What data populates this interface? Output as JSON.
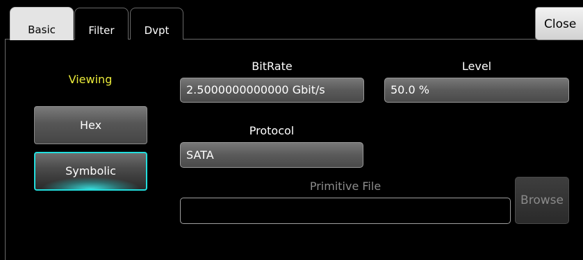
{
  "tabs": [
    {
      "label": "Basic",
      "active": true
    },
    {
      "label": "Filter",
      "active": false
    },
    {
      "label": "Dvpt",
      "active": false
    }
  ],
  "close_label": "Close",
  "viewing": {
    "title": "Viewing",
    "options": [
      {
        "label": "Hex",
        "selected": false
      },
      {
        "label": "Symbolic",
        "selected": true
      }
    ]
  },
  "bitrate": {
    "label": "BitRate",
    "value": "2.5000000000000 Gbit/s"
  },
  "level": {
    "label": "Level",
    "value": "50.0 %"
  },
  "protocol": {
    "label": "Protocol",
    "value": "SATA"
  },
  "primitive_file": {
    "label": "Primitive File",
    "value": "",
    "browse_label": "Browse",
    "enabled": false
  },
  "colors": {
    "accent_cyan": "#22dede",
    "label_yellow": "#eaea3a",
    "active_tab_bg": "#e4e4e4"
  }
}
